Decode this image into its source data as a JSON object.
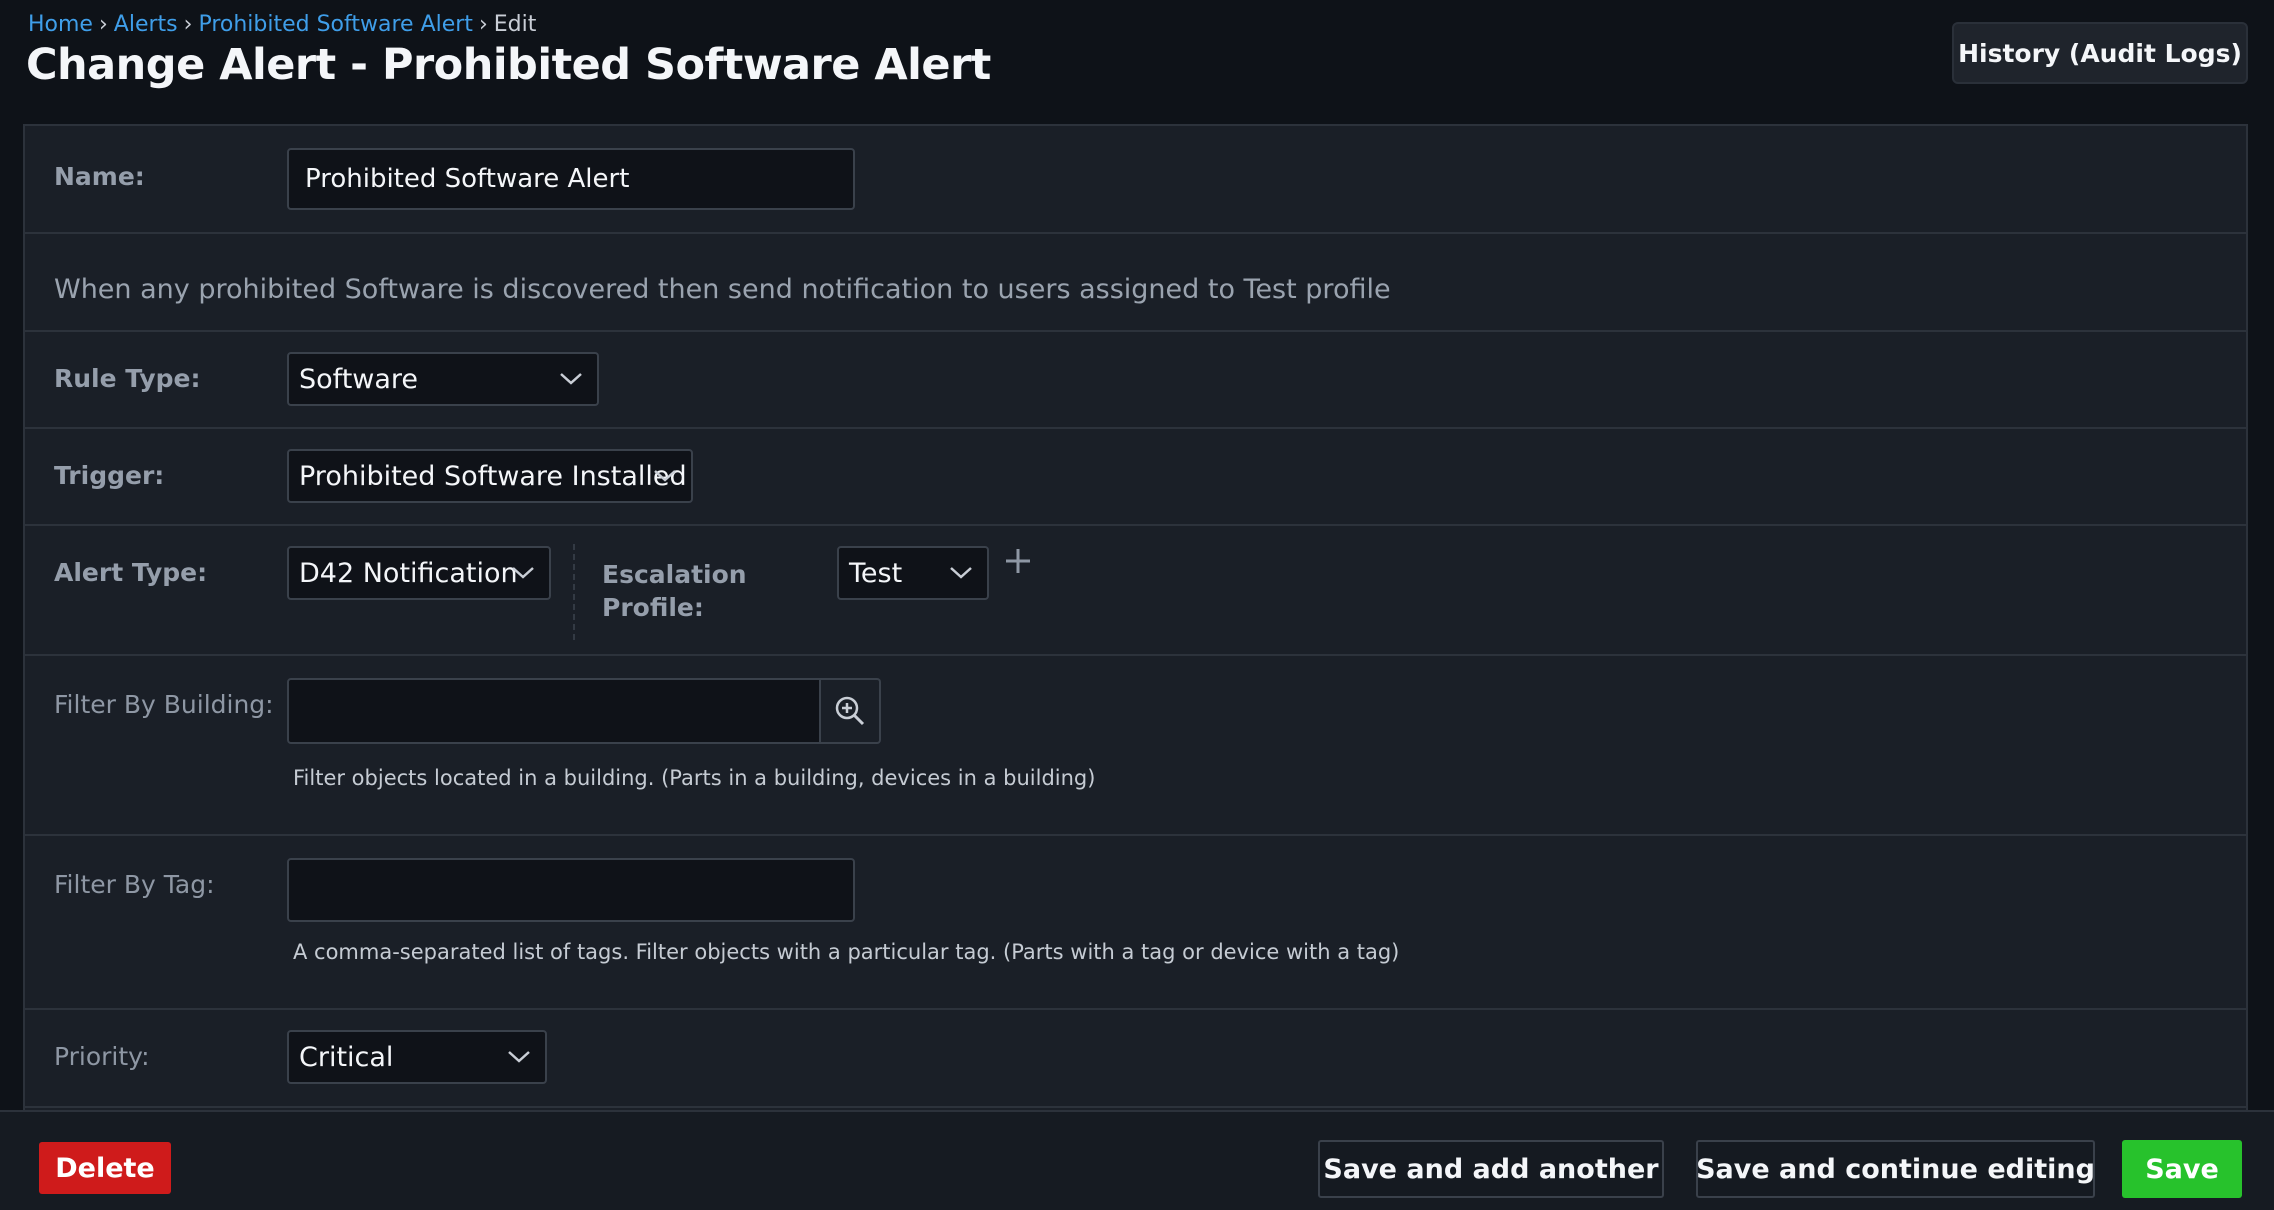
{
  "breadcrumb": {
    "home": "Home",
    "alerts": "Alerts",
    "current": "Prohibited Software Alert",
    "edit": "Edit",
    "separator": "›"
  },
  "page_title": "Change Alert - Prohibited Software Alert",
  "history_button": "History (Audit Logs)",
  "form": {
    "name_label": "Name:",
    "name_value": "Prohibited Software Alert",
    "description": "When any prohibited Software is discovered then send notification to users assigned to Test profile",
    "rule_type_label": "Rule Type:",
    "rule_type_value": "Software",
    "trigger_label": "Trigger:",
    "trigger_value": "Prohibited Software Installed",
    "alert_type_label": "Alert Type:",
    "alert_type_value": "D42 Notification",
    "escalation_label_line1": "Escalation",
    "escalation_label_line2": "Profile:",
    "escalation_value": "Test",
    "filter_building_label": "Filter By Building:",
    "filter_building_value": "",
    "filter_building_help": "Filter objects located in a building. (Parts in a building, devices in a building)",
    "filter_tag_label": "Filter By Tag:",
    "filter_tag_value": "",
    "filter_tag_help": "A comma-separated list of tags. Filter objects with a particular tag. (Parts with a tag or device with a tag)",
    "priority_label": "Priority:",
    "priority_value": "Critical"
  },
  "footer": {
    "delete": "Delete",
    "save_add_another": "Save and add another",
    "save_continue": "Save and continue editing",
    "save": "Save"
  },
  "colors": {
    "link": "#3f9ee9",
    "delete": "#cf1b1b",
    "save": "#27c22c",
    "background": "#0e1218",
    "panel": "#1a1f27"
  },
  "icons": [
    "chevron-down-icon",
    "plus-icon",
    "zoom-in-icon"
  ]
}
